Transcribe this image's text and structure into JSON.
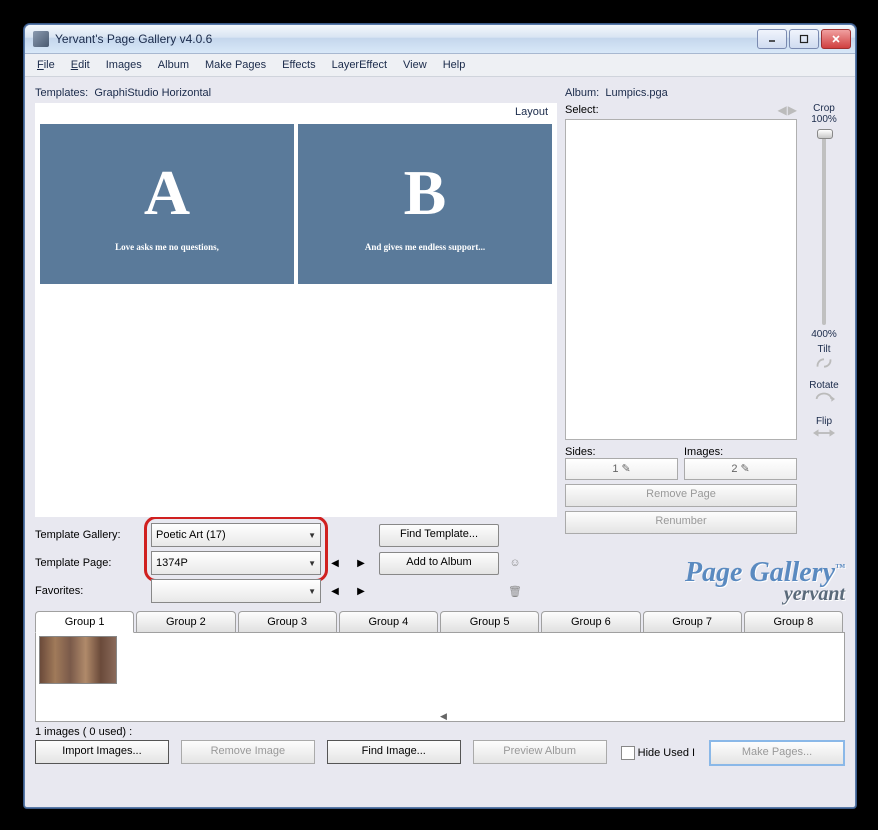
{
  "window": {
    "title": "Yervant's Page Gallery v4.0.6"
  },
  "menu": {
    "file": "File",
    "edit": "Edit",
    "images": "Images",
    "album": "Album",
    "makepages": "Make Pages",
    "effects": "Effects",
    "layereffect": "LayerEffect",
    "view": "View",
    "help": "Help"
  },
  "templates": {
    "label": "Templates:",
    "name": "GraphiStudio Horizontal",
    "layout_label": "Layout",
    "pageA": {
      "letter": "A",
      "caption": "Love asks me no questions,"
    },
    "pageB": {
      "letter": "B",
      "caption": "And gives me endless support..."
    }
  },
  "controls": {
    "gallery_label": "Template Gallery:",
    "gallery_value": "Poetic Art (17)",
    "page_label": "Template Page:",
    "page_value": "1374P",
    "favorites_label": "Favorites:",
    "find_template": "Find Template...",
    "add_to_album": "Add to Album"
  },
  "album": {
    "label": "Album:",
    "name": "Lumpics.pga",
    "select_label": "Select:",
    "crop_label": "Crop",
    "crop_top": "100%",
    "crop_bottom": "400%",
    "tilt_label": "Tilt",
    "rotate_label": "Rotate",
    "flip_label": "Flip",
    "sides_label": "Sides:",
    "images_label": "Images:",
    "sides_value": "1",
    "images_value": "2",
    "remove_page": "Remove Page",
    "renumber": "Renumber"
  },
  "logo": {
    "line1": "Page Gallery",
    "tm": "™",
    "line2": "yervant"
  },
  "tabs": [
    "Group 1",
    "Group 2",
    "Group 3",
    "Group 4",
    "Group 5",
    "Group 6",
    "Group 7",
    "Group 8"
  ],
  "status": "1 images ( 0 used) :",
  "bottom": {
    "import": "Import Images...",
    "remove": "Remove Image",
    "find": "Find Image...",
    "preview": "Preview Album",
    "hide": "Hide Used I",
    "make": "Make Pages..."
  }
}
